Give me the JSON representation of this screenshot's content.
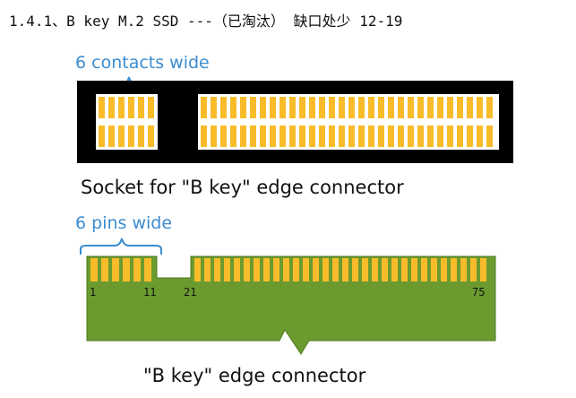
{
  "heading": "1.4.1、B key M.2 SSD ---（已淘汰） 缺口处少 12-19",
  "socket": {
    "width_label": "6 contacts wide",
    "caption": "Socket for \"B key\" edge connector"
  },
  "connector": {
    "width_label": "6 pins wide",
    "caption": "\"B key\" edge connector",
    "pin_labels": [
      "1",
      "11",
      "21",
      "75"
    ]
  },
  "colors": {
    "blue_label": "#3b8ccf",
    "contact_gold": "#f8bc2a",
    "socket_black": "#000000",
    "pcb_green": "#6b9b2f",
    "pcb_edge": "#4f7a22",
    "caption_text": "#111111"
  }
}
